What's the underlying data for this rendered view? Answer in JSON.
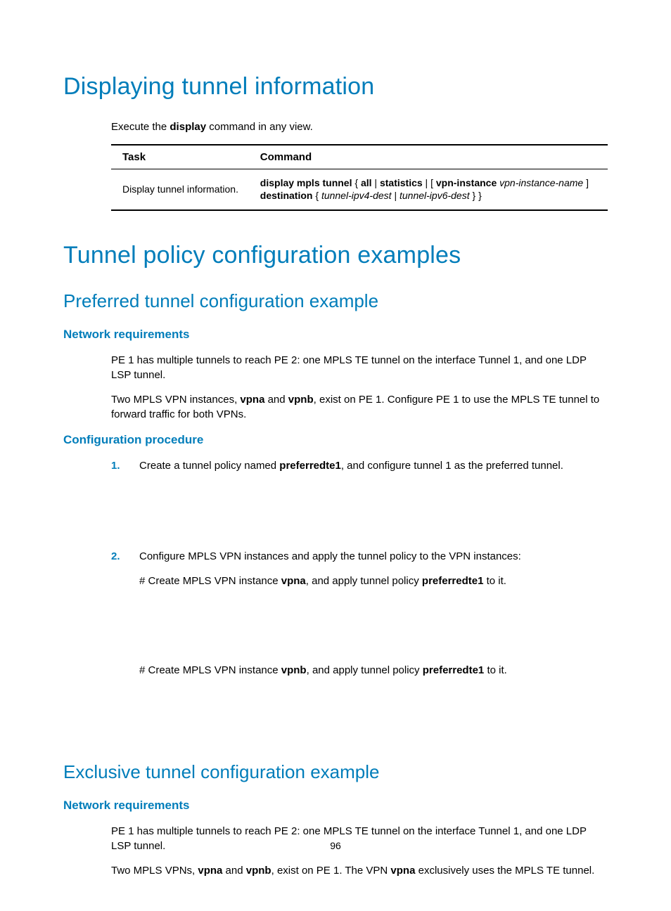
{
  "page_number": "96",
  "h1_display": "Displaying tunnel information",
  "intro": {
    "pre": "Execute the ",
    "bold": "display",
    "post": " command in any view."
  },
  "table": {
    "th_task": "Task",
    "th_command": "Command",
    "task": "Display tunnel information.",
    "cmd": {
      "p1": "display mpls tunnel",
      "p2": " { ",
      "p3": "all",
      "p4": " | ",
      "p5": "statistics",
      "p6": " | [ ",
      "p7": "vpn-instance",
      "p8": " ",
      "p9": "vpn-instance-name",
      "p10": " ] ",
      "p11": "destination",
      "p12": " { ",
      "p13": "tunnel-ipv4-dest",
      "p14": " | ",
      "p15": "tunnel-ipv6-dest",
      "p16": " } }"
    }
  },
  "h1_examples": "Tunnel policy configuration examples",
  "h2_preferred": "Preferred tunnel configuration example",
  "h3_netreq": "Network requirements",
  "pref_p1": "PE 1 has multiple tunnels to reach PE 2: one MPLS TE tunnel on the interface Tunnel 1, and one LDP LSP tunnel.",
  "pref_p2": {
    "t1": "Two MPLS VPN instances, ",
    "b1": "vpna",
    "t2": " and ",
    "b2": "vpnb",
    "t3": ", exist on PE 1. Configure PE 1 to use the MPLS TE tunnel to forward traffic for both VPNs."
  },
  "h3_confproc": "Configuration procedure",
  "step1": {
    "num": "1.",
    "t1": "Create a tunnel policy named ",
    "b1": "preferredte1",
    "t2": ", and configure tunnel 1 as the preferred tunnel."
  },
  "step2": {
    "num": "2.",
    "line": "Configure MPLS VPN instances and apply the tunnel policy to the VPN instances:",
    "sub1": {
      "t1": "# Create MPLS VPN instance ",
      "b1": "vpna",
      "t2": ", and apply tunnel policy ",
      "b2": "preferredte1",
      "t3": " to it."
    },
    "sub2": {
      "t1": "# Create MPLS VPN instance ",
      "b1": "vpnb",
      "t2": ", and apply tunnel policy ",
      "b2": "preferredte1",
      "t3": " to it."
    }
  },
  "h2_exclusive": "Exclusive tunnel configuration example",
  "excl_p1": "PE 1 has multiple tunnels to reach PE 2: one MPLS TE tunnel on the interface Tunnel 1, and one LDP LSP tunnel.",
  "excl_p2": {
    "t1": "Two MPLS VPNs, ",
    "b1": "vpna",
    "t2": " and ",
    "b2": "vpnb",
    "t3": ", exist on PE 1. The VPN ",
    "b3": "vpna",
    "t4": " exclusively uses the MPLS TE tunnel."
  }
}
